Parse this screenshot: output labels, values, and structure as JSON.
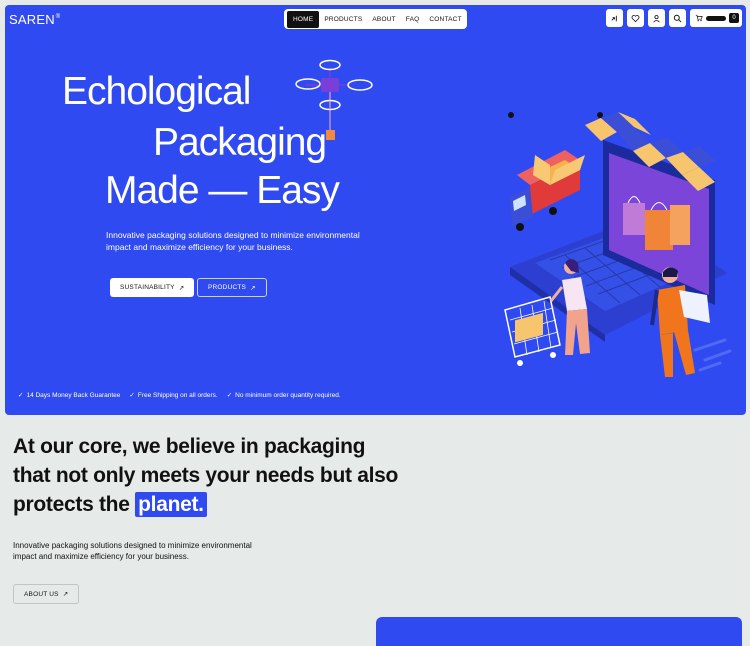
{
  "brand": {
    "name": "SAREN",
    "mark": "®"
  },
  "nav": {
    "items": [
      "HOME",
      "PRODUCTS",
      "ABOUT",
      "FAQ",
      "CONTACT"
    ],
    "active": "HOME"
  },
  "toolbar": {
    "icons": [
      "compare-icon",
      "heart-icon",
      "user-icon",
      "search-icon",
      "cart-icon"
    ],
    "cart_count": "0"
  },
  "hero": {
    "line1": "Echological",
    "line2": "Packaging",
    "line3": "Made — Easy",
    "lead": "Innovative packaging solutions designed to minimize environmental impact and maximize efficiency for your business.",
    "primary_button": "SUSTAINABILITY",
    "secondary_button": "PRODUCTS",
    "guarantees": [
      "14 Days Money Back Guarantee",
      "Free Shipping on all orders.",
      "No minimum order quantity required."
    ]
  },
  "about": {
    "title_start": "At our core, we believe in packaging that not only meets your needs but also protects the",
    "title_highlight": "planet.",
    "text": "Innovative packaging solutions designed to minimize environmental impact and maximize efficiency for your business.",
    "button": "ABOUT US"
  },
  "colors": {
    "accent": "#2f4af0",
    "background": "#e6ebe9",
    "ink": "#111111"
  }
}
